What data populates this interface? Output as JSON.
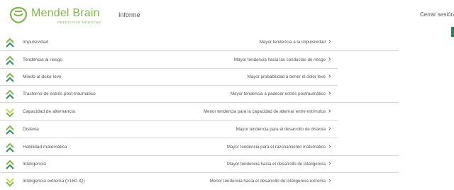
{
  "header": {
    "brand_title": "Mendel Brain",
    "brand_subtitle": "PREDICTIVE MEDICINE",
    "nav_informe": "Informe",
    "logout": "Cerrar sesión"
  },
  "colors": {
    "brand_green": "#7fb848",
    "accent_dark_green": "#1e8a5a"
  },
  "items": [
    {
      "label": "Impulsividad",
      "description": "Mayor tendencia a la impulsividad",
      "icon": "chevron-up-icon"
    },
    {
      "label": "Tendencia al riesgo",
      "description": "Mayor tendencia hacia las conductas de riesgo",
      "icon": "chevron-up-icon"
    },
    {
      "label": "Miedo al dolor leve",
      "description": "Mayor probabilidad a temer el dolor leve",
      "icon": "chevron-up-icon"
    },
    {
      "label": "Trastorno de estrés post-traumático",
      "description": "Mayor tendencia a padecer estrés postraumático",
      "icon": "chevron-up-icon"
    },
    {
      "label": "Capacidad de alternancia",
      "description": "Menor tendencia para la capacidad de alternar entre estímulos",
      "icon": "chevron-down-icon"
    },
    {
      "label": "Dislexia",
      "description": "Mayor tendencia para el desarrollo de dislexia",
      "icon": "chevron-up-icon"
    },
    {
      "label": "Habilidad matemática",
      "description": "Mayor tendencia para el razonamiento matemático",
      "icon": "chevron-up-icon"
    },
    {
      "label": "Inteligencia",
      "description": "Mayor tendencia hacia el desarrollo de inteligencia",
      "icon": "chevron-up-icon"
    },
    {
      "label": "Inteligencia extrema (>160 IQ)",
      "description": "Menor tendencia hacia el desarrollo de inteligencia extrema",
      "icon": "chevron-down-icon"
    }
  ]
}
